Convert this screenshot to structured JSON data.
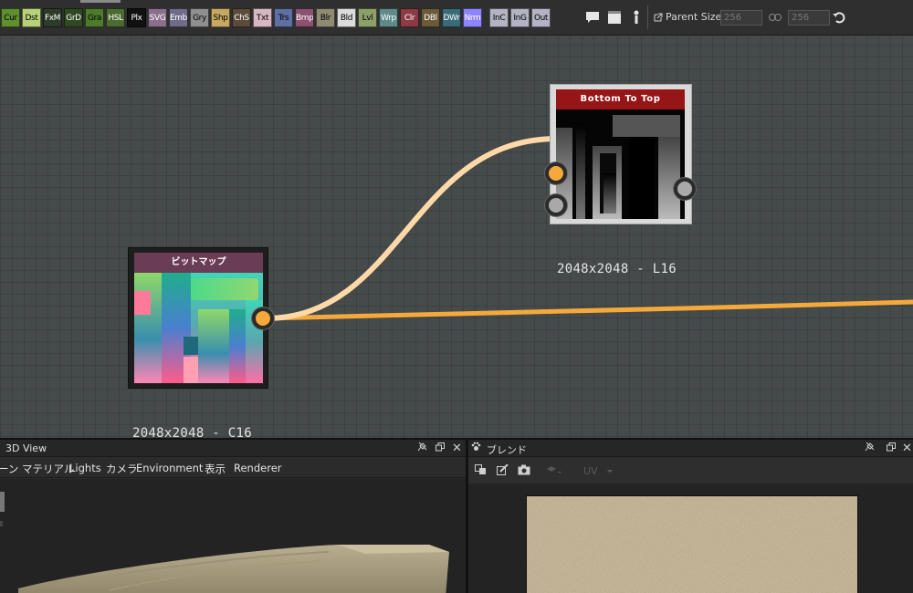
{
  "toolbar": {
    "categories": [
      {
        "label": "Cur",
        "bg": "#5f8f2e",
        "fg": "#000000"
      },
      {
        "label": "Dst",
        "bg": "#b8d27a",
        "fg": "#000000"
      },
      {
        "label": "FxM",
        "bg": "#2e3b2a",
        "fg": "#ffffff"
      },
      {
        "label": "GrD",
        "bg": "#2f4a23",
        "fg": "#ffffff"
      },
      {
        "label": "Gra",
        "bg": "#4d7a2c",
        "fg": "#000000"
      },
      {
        "label": "HSL",
        "bg": "#4c6a32",
        "fg": "#ffffff"
      },
      {
        "label": "Plx",
        "bg": "#111111",
        "fg": "#ffffff"
      },
      {
        "label": "SVG",
        "bg": "#8a6e8c",
        "fg": "#ffffff"
      },
      {
        "label": "Emb",
        "bg": "#6f6c8a",
        "fg": "#ffffff"
      },
      {
        "label": "Gry",
        "bg": "#8f8f8f",
        "fg": "#000000"
      },
      {
        "label": "Shp",
        "bg": "#c8a860",
        "fg": "#000000"
      },
      {
        "label": "ChS",
        "bg": "#5a4b3a",
        "fg": "#ffffff"
      },
      {
        "label": "Txt",
        "bg": "#d9b7c2",
        "fg": "#000000"
      },
      {
        "label": "Trs",
        "bg": "#5e6fa3",
        "fg": "#000000"
      },
      {
        "label": "Bmp",
        "bg": "#8a5170",
        "fg": "#ffffff"
      },
      {
        "label": "Blr",
        "bg": "#8e8b72",
        "fg": "#000000"
      },
      {
        "label": "Bld",
        "bg": "#dcdcdc",
        "fg": "#000000"
      },
      {
        "label": "Lvl",
        "bg": "#8ea06a",
        "fg": "#000000"
      },
      {
        "label": "Wrp",
        "bg": "#5f8a8a",
        "fg": "#ffffff"
      },
      {
        "label": "Clr",
        "bg": "#8c3a44",
        "fg": "#ffffff"
      },
      {
        "label": "DBl",
        "bg": "#6b5a3a",
        "fg": "#ffffff"
      },
      {
        "label": "DWr",
        "bg": "#3a6a78",
        "fg": "#ffffff"
      },
      {
        "label": "Nrm",
        "bg": "#8f84ff",
        "fg": "#ffffff"
      },
      {
        "label": "InC",
        "bg": "#b3b3c4",
        "fg": "#000000",
        "gap": true
      },
      {
        "label": "InG",
        "bg": "#b3b3c4",
        "fg": "#000000"
      },
      {
        "label": "Out",
        "bg": "#b3b3c4",
        "fg": "#000000"
      }
    ],
    "parent_size_label": "Parent Size:",
    "width_value": "256",
    "height_value": "256"
  },
  "graph": {
    "bitmap_node": {
      "title": "ビットマップ",
      "caption": "2048x2048 - C16",
      "title_color": "#6b3c55"
    },
    "gradient_node": {
      "title": "Bottom To Top",
      "caption": "2048x2048 - L16",
      "title_color": "#961516"
    },
    "wire_colors": {
      "main": "#f6a93b",
      "selected": "#ffd8a8"
    }
  },
  "panel3d": {
    "title": "3D View",
    "menu": [
      "ーン",
      "マテリアル",
      "Lights",
      "カメラ",
      "Environment",
      "表示",
      "Renderer"
    ]
  },
  "panelBlend": {
    "title": "ブレンド",
    "uv_label": "UV"
  }
}
